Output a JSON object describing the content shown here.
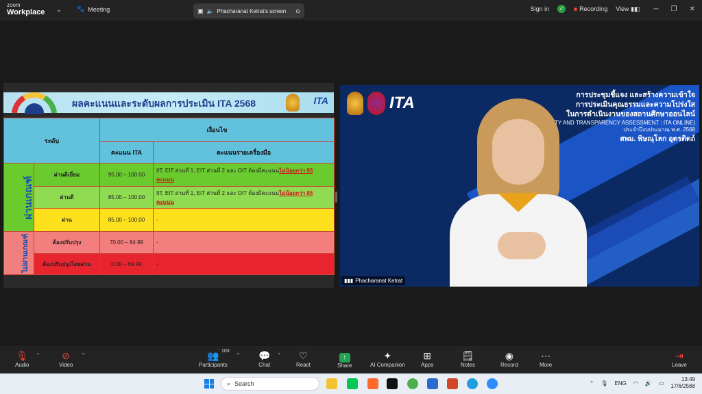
{
  "topbar": {
    "brand_top": "zoom",
    "brand_bottom": "Workplace",
    "meeting_label": "Meeting",
    "share_label": "Phacharanat Ketrat's screen",
    "sign_in": "Sign in",
    "recording": "Recording",
    "view": "View"
  },
  "slide": {
    "title": "ผลคะแนนและระดับผลการประเมิน ITA 2568",
    "logo": "ITA",
    "headers": {
      "level": "ระดับ",
      "condition": "เงื่อนไข",
      "ita_score": "คะแนน ITA",
      "tool_score": "คะแนนรายเครื่องมือ"
    },
    "pass_group": "ผ่านเกณฑ์",
    "fail_group": "ไม่ผ่านเกณฑ์",
    "rows": [
      {
        "level": "ผ่านดีเยี่ยม",
        "score": "95.00 – 100.00",
        "desc": "IIT, EIT ส่วนที่ 1, EIT ส่วนที่ 2 และ OIT ต้องมีคะแนน",
        "highlight": "ไม่น้อยกว่า 95 คะแนน"
      },
      {
        "level": "ผ่านดี",
        "score": "85.00 – 100.00",
        "desc": "IIT, EIT ส่วนที่ 1, EIT ส่วนที่ 2 และ OIT ต้องมีคะแนน",
        "highlight": "ไม่น้อยกว่า 85 คะแนน"
      },
      {
        "level": "ผ่าน",
        "score": "85.00 – 100.00",
        "desc": "-",
        "highlight": ""
      },
      {
        "level": "ต้องปรับปรุง",
        "score": "70.00 – 84.99",
        "desc": "-",
        "highlight": ""
      },
      {
        "level": "ต้องปรับปรุงโดยด่วน",
        "score": "0.00 – 69.99",
        "desc": "-",
        "highlight": ""
      }
    ]
  },
  "video": {
    "logo": "ITA",
    "line1": "การประชุมชี้แจง และสร้างความเข้าใจ",
    "line2": "การประเมินคุณธรรมและความโปร่งใส",
    "line3": "ในการดำเนินงานของสถานศึกษาออนไลน์",
    "line4": "TY AND TRANSPARENCY ASSESSMENT : ITA ONLINE)",
    "line5": "ประจำปีงบประมาณ พ.ศ. 2568",
    "line6": "สพม. พิษณุโลก อุตรดิตถ์",
    "name": "Phacharanat Ketrat"
  },
  "toolbar": {
    "audio": "Audio",
    "video": "Video",
    "participants": "Participants",
    "participants_count": "103",
    "chat": "Chat",
    "react": "React",
    "share": "Share",
    "ai": "AI Companion",
    "apps": "Apps",
    "notes": "Notes",
    "record": "Record",
    "more": "More",
    "leave": "Leave"
  },
  "taskbar": {
    "search": "Search",
    "lang": "ENG",
    "time": "13:49",
    "date": "17/6/2568"
  }
}
